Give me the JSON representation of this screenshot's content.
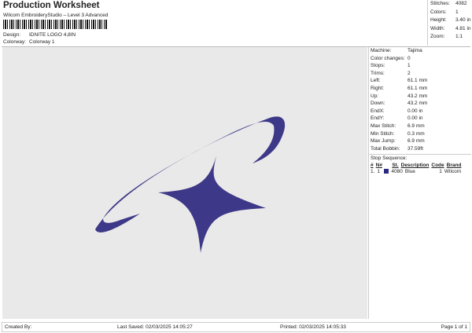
{
  "header": {
    "title": "Production Worksheet",
    "subtitle": "Wilcom EmbroideryStudio – Level 3 Advanced",
    "design_label": "Design:",
    "design": "IDNITE LOGO 4,8IN",
    "colorway_label": "Colorway:",
    "colorway": "Colorway 1"
  },
  "stats": [
    {
      "k": "Stitches:",
      "v": "4082"
    },
    {
      "k": "Colors:",
      "v": "1"
    },
    {
      "k": "Height:",
      "v": "3.40 in"
    },
    {
      "k": "Width:",
      "v": "4.81 in"
    },
    {
      "k": "Zoom:",
      "v": "1:1"
    }
  ],
  "details": [
    {
      "k": "Machine:",
      "v": "Tajima"
    },
    {
      "k": "Color changes:",
      "v": "0"
    },
    {
      "k": "Stops:",
      "v": "1"
    },
    {
      "k": "Trims:",
      "v": "2"
    },
    {
      "k": "Left:",
      "v": "61.1 mm"
    },
    {
      "k": "Right:",
      "v": "61.1 mm"
    },
    {
      "k": "Up:",
      "v": "43.2 mm"
    },
    {
      "k": "Down:",
      "v": "43.2 mm"
    },
    {
      "k": "EndX:",
      "v": "0.00 in"
    },
    {
      "k": "EndY:",
      "v": "0.00 in"
    },
    {
      "k": "Max Stitch:",
      "v": "6.9 mm"
    },
    {
      "k": "Min Stitch:",
      "v": "0.3 mm"
    },
    {
      "k": "Max Jump:",
      "v": "6.9 mm"
    },
    {
      "k": "Total Bobbin:",
      "v": "37.59ft"
    }
  ],
  "stop_sequence": {
    "label": "Stop Sequence:",
    "headers": [
      "#",
      "N#",
      "St.",
      "Description",
      "Code",
      "Brand"
    ],
    "rows": [
      {
        "num": "1.",
        "n": "1",
        "st": "4080",
        "desc": "Blue",
        "code": "1",
        "brand": "Wilcom",
        "color": "#2a2880"
      }
    ]
  },
  "design_color": "#3d3888",
  "footer": {
    "created": "Created By:",
    "saved": "Last Saved: 02/03/2025 14:05:27",
    "printed": "Printed: 02/03/2025 14:05:33",
    "page": "Page 1 of 1"
  }
}
